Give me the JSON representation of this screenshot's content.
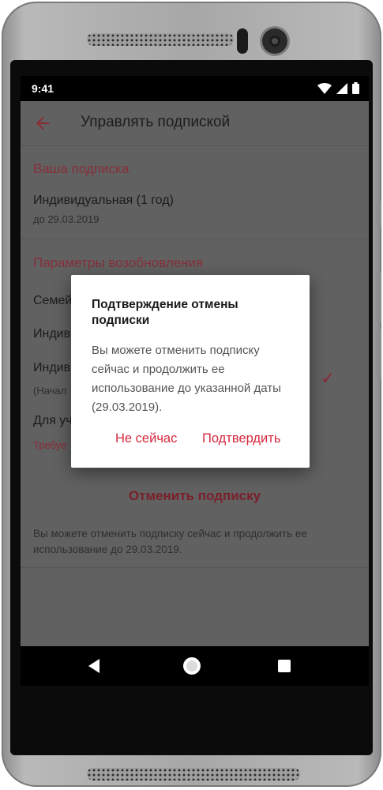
{
  "status": {
    "time": "9:41"
  },
  "toolbar": {
    "title": "Управлять подпиской"
  },
  "subscription": {
    "section_title": "Ваша подписка",
    "plan": "Индивидуальная  (1 год)",
    "until": "до 29.03.2019"
  },
  "renewal": {
    "section_title": "Параметры возобновления",
    "options": [
      {
        "label": "Семей"
      },
      {
        "label": "Индив"
      },
      {
        "label": "Индив",
        "sub": "(Начал",
        "selected": true
      },
      {
        "label": "Для уч",
        "sub": "Требуе"
      }
    ]
  },
  "cancel_label": "Отменить подписку",
  "note": "Вы можете отменить подписку сейчас и продолжить ее использование до 29.03.2019.",
  "dialog": {
    "title": "Подтверждение отмены подписки",
    "body": "Вы можете отменить подписку сейчас и продолжить ее использование до указанной даты (29.03.2019).",
    "negative": "Не сейчас",
    "positive": "Подтвердить"
  },
  "colors": {
    "accent": "#d6283f",
    "section": "#86303a"
  }
}
